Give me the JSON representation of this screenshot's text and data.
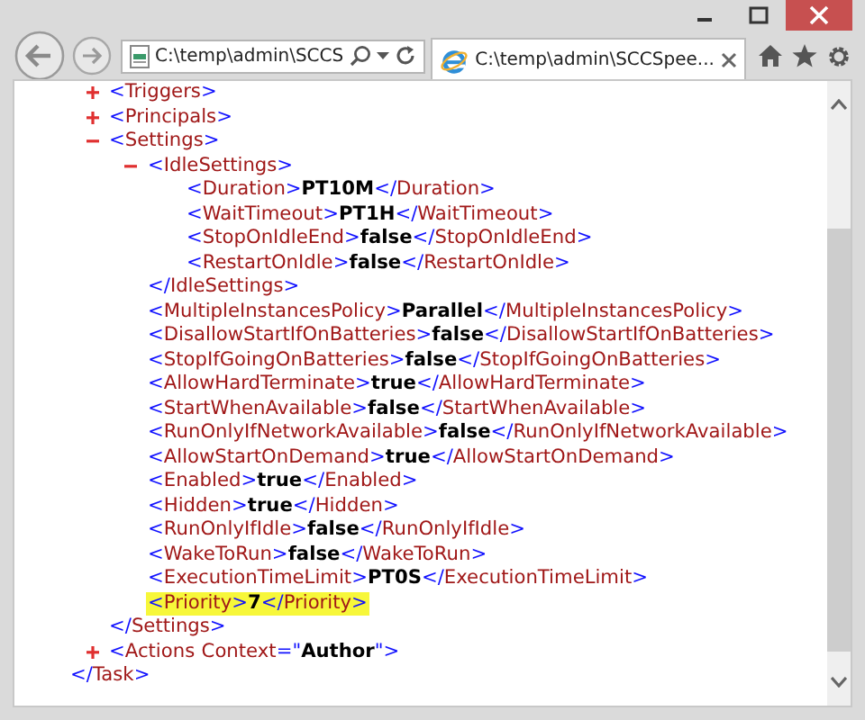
{
  "browser": {
    "address": "C:\\temp\\admin\\SCCS",
    "tabs": [
      {
        "title": "C:\\temp\\admin\\SCCSpee...",
        "selected": true
      }
    ]
  },
  "syntax": {
    "lt": "<",
    "gt": ">",
    "slash": "/",
    "eq": "=",
    "quote": "\""
  },
  "document": {
    "nodes": [
      {
        "tag": "Triggers",
        "expanded": false
      },
      {
        "tag": "Principals",
        "expanded": false
      },
      {
        "tag": "Settings",
        "expanded": true,
        "close_tag": "Settings",
        "children": [
          {
            "tag": "IdleSettings",
            "expanded": true,
            "close_tag": "IdleSettings",
            "children": [
              {
                "tag": "Duration",
                "value": "PT10M",
                "close_tag": "Duration",
                "highlighted": false
              },
              {
                "tag": "WaitTimeout",
                "value": "PT1H",
                "close_tag": "WaitTimeout",
                "highlighted": false
              },
              {
                "tag": "StopOnIdleEnd",
                "value": "false",
                "close_tag": "StopOnIdleEnd",
                "highlighted": false
              },
              {
                "tag": "RestartOnIdle",
                "value": "false",
                "close_tag": "RestartOnIdle",
                "highlighted": false
              }
            ]
          },
          {
            "tag": "MultipleInstancesPolicy",
            "value": "Parallel",
            "close_tag": "MultipleInstancesPolicy",
            "highlighted": false
          },
          {
            "tag": "DisallowStartIfOnBatteries",
            "value": "false",
            "close_tag": "DisallowStartIfOnBatteries",
            "highlighted": false
          },
          {
            "tag": "StopIfGoingOnBatteries",
            "value": "false",
            "close_tag": "StopIfGoingOnBatteries",
            "highlighted": false
          },
          {
            "tag": "AllowHardTerminate",
            "value": "true",
            "close_tag": "AllowHardTerminate",
            "highlighted": false
          },
          {
            "tag": "StartWhenAvailable",
            "value": "false",
            "close_tag": "StartWhenAvailable",
            "highlighted": false
          },
          {
            "tag": "RunOnlyIfNetworkAvailable",
            "value": "false",
            "close_tag": "RunOnlyIfNetworkAvailable",
            "highlighted": false
          },
          {
            "tag": "AllowStartOnDemand",
            "value": "true",
            "close_tag": "AllowStartOnDemand",
            "highlighted": false
          },
          {
            "tag": "Enabled",
            "value": "true",
            "close_tag": "Enabled",
            "highlighted": false
          },
          {
            "tag": "Hidden",
            "value": "true",
            "close_tag": "Hidden",
            "highlighted": false
          },
          {
            "tag": "RunOnlyIfIdle",
            "value": "false",
            "close_tag": "RunOnlyIfIdle",
            "highlighted": false
          },
          {
            "tag": "WakeToRun",
            "value": "false",
            "close_tag": "WakeToRun",
            "highlighted": false
          },
          {
            "tag": "ExecutionTimeLimit",
            "value": "PT0S",
            "close_tag": "ExecutionTimeLimit",
            "highlighted": false
          },
          {
            "tag": "Priority",
            "value": "7",
            "close_tag": "Priority",
            "highlighted": true
          }
        ]
      },
      {
        "tag": "Actions",
        "expanded": false,
        "attributes": [
          {
            "name": "Context",
            "value": "Author"
          }
        ]
      }
    ],
    "closing_tag": "Task"
  }
}
